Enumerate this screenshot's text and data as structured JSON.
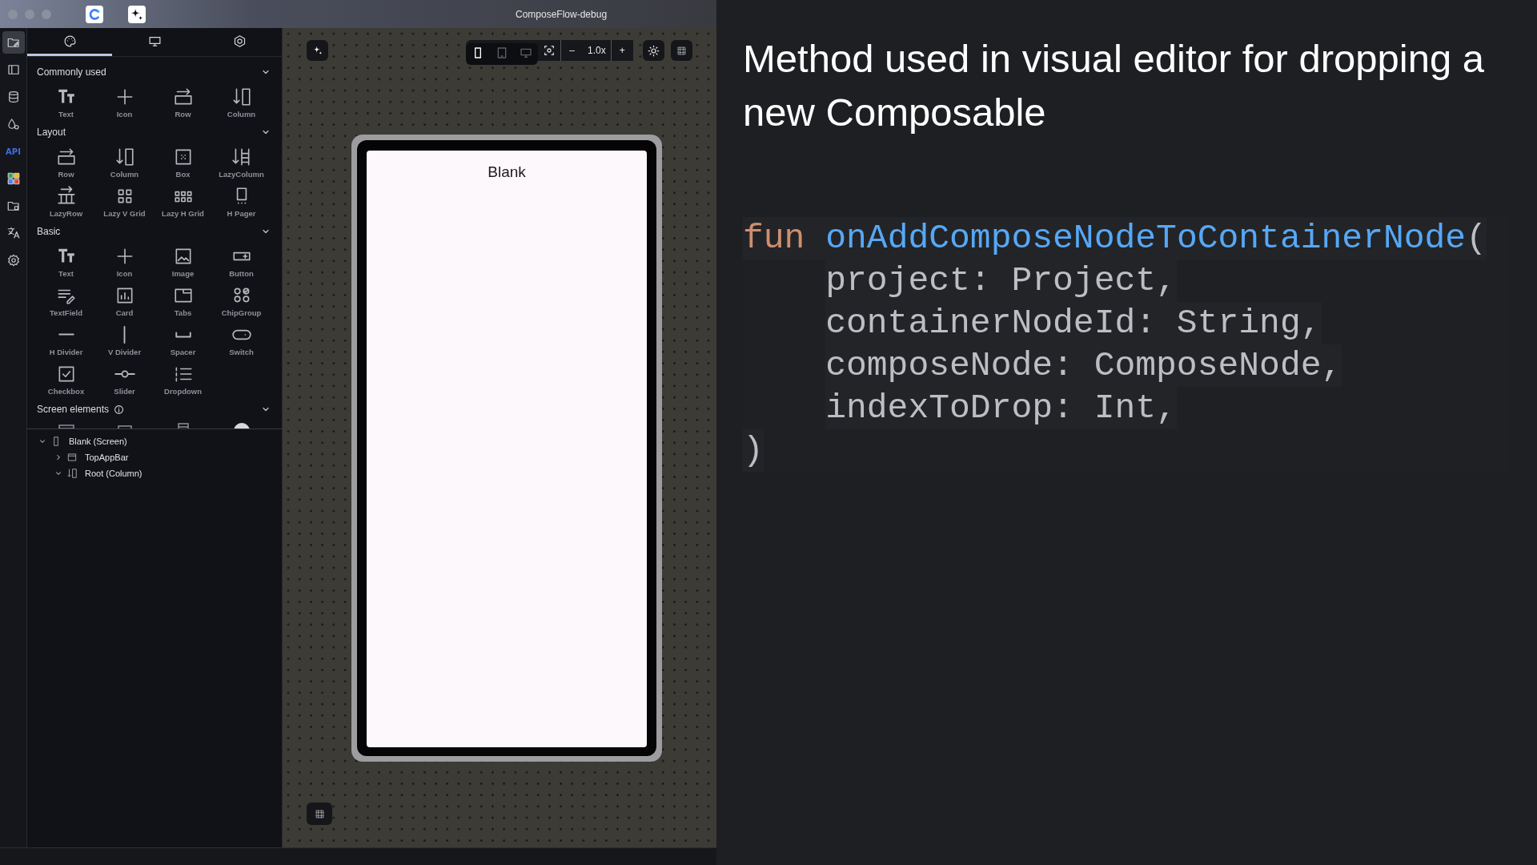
{
  "window": {
    "title": "ComposeFlow-debug"
  },
  "rail": [
    {
      "kind": "editor",
      "selected": true
    },
    {
      "kind": "panel",
      "selected": false
    },
    {
      "kind": "database",
      "selected": false
    },
    {
      "kind": "assets",
      "selected": false
    },
    {
      "kind": "api",
      "label": "API",
      "selected": false
    },
    {
      "kind": "apps",
      "selected": false
    },
    {
      "kind": "folder",
      "selected": false
    },
    {
      "kind": "translate",
      "selected": false
    },
    {
      "kind": "settings",
      "selected": false
    }
  ],
  "panel_tabs": [
    {
      "kind": "palette",
      "selected": true
    },
    {
      "kind": "monitor",
      "selected": false
    },
    {
      "kind": "hexagon",
      "selected": false
    }
  ],
  "palette": [
    {
      "title": "Commonly used",
      "expanded": true,
      "items": [
        {
          "label": "Text",
          "kind": "text"
        },
        {
          "label": "Icon",
          "kind": "icon"
        },
        {
          "label": "Row",
          "kind": "row"
        },
        {
          "label": "Column",
          "kind": "column"
        }
      ]
    },
    {
      "title": "Layout",
      "expanded": true,
      "items": [
        {
          "label": "Row",
          "kind": "row"
        },
        {
          "label": "Column",
          "kind": "column"
        },
        {
          "label": "Box",
          "kind": "box"
        },
        {
          "label": "LazyColumn",
          "kind": "lazycolumn"
        },
        {
          "label": "LazyRow",
          "kind": "lazyrow"
        },
        {
          "label": "Lazy V Grid",
          "kind": "lazyvgrid"
        },
        {
          "label": "Lazy H Grid",
          "kind": "lazyhgrid"
        },
        {
          "label": "H Pager",
          "kind": "hpager"
        }
      ]
    },
    {
      "title": "Basic",
      "expanded": true,
      "items": [
        {
          "label": "Text",
          "kind": "text"
        },
        {
          "label": "Icon",
          "kind": "icon"
        },
        {
          "label": "Image",
          "kind": "image"
        },
        {
          "label": "Button",
          "kind": "button"
        },
        {
          "label": "TextField",
          "kind": "textfield"
        },
        {
          "label": "Card",
          "kind": "card"
        },
        {
          "label": "Tabs",
          "kind": "tabs"
        },
        {
          "label": "ChipGroup",
          "kind": "chipgroup"
        },
        {
          "label": "H Divider",
          "kind": "hdivider"
        },
        {
          "label": "V Divider",
          "kind": "vdivider"
        },
        {
          "label": "Spacer",
          "kind": "spacer"
        },
        {
          "label": "Switch",
          "kind": "switch"
        },
        {
          "label": "Checkbox",
          "kind": "checkbox"
        },
        {
          "label": "Slider",
          "kind": "slider"
        },
        {
          "label": "Dropdown",
          "kind": "dropdown"
        }
      ]
    }
  ],
  "screen_elements": {
    "title": "Screen elements",
    "expanded": true
  },
  "tree": [
    {
      "label": "Blank (Screen)",
      "kind": "screen",
      "expanded": true,
      "children": [
        {
          "label": "TopAppBar",
          "kind": "appbar",
          "expanded": false
        },
        {
          "label": "Root (Column)",
          "kind": "column",
          "expanded": true
        }
      ]
    }
  ],
  "canvas_toolbar": {
    "devices": [
      {
        "kind": "phone",
        "selected": true
      },
      {
        "kind": "tablet",
        "selected": false
      },
      {
        "kind": "desktop",
        "selected": false
      }
    ],
    "zoom_out": "–",
    "zoom": "1.0x",
    "zoom_in": "+"
  },
  "preview": {
    "screen_title": "Blank"
  },
  "slide": {
    "heading": "Method used in visual editor for dropping a new Composable",
    "code": [
      {
        "indent": false,
        "tokens": [
          {
            "kind": "keyword",
            "text": "fun"
          },
          {
            "kind": "function",
            "text": "onAddComposeNodeToContainerNode"
          },
          {
            "kind": "plain",
            "text": "("
          }
        ]
      },
      {
        "indent": true,
        "tokens": [
          {
            "kind": "plain",
            "text": "project: Project,"
          }
        ]
      },
      {
        "indent": true,
        "tokens": [
          {
            "kind": "plain",
            "text": "containerNodeId: String,"
          }
        ]
      },
      {
        "indent": true,
        "tokens": [
          {
            "kind": "plain",
            "text": "composeNode: ComposeNode,"
          }
        ]
      },
      {
        "indent": true,
        "tokens": [
          {
            "kind": "plain",
            "text": "indexToDrop: Int,"
          }
        ]
      },
      {
        "indent": false,
        "tokens": [
          {
            "kind": "plain",
            "text": ")"
          }
        ]
      }
    ]
  }
}
